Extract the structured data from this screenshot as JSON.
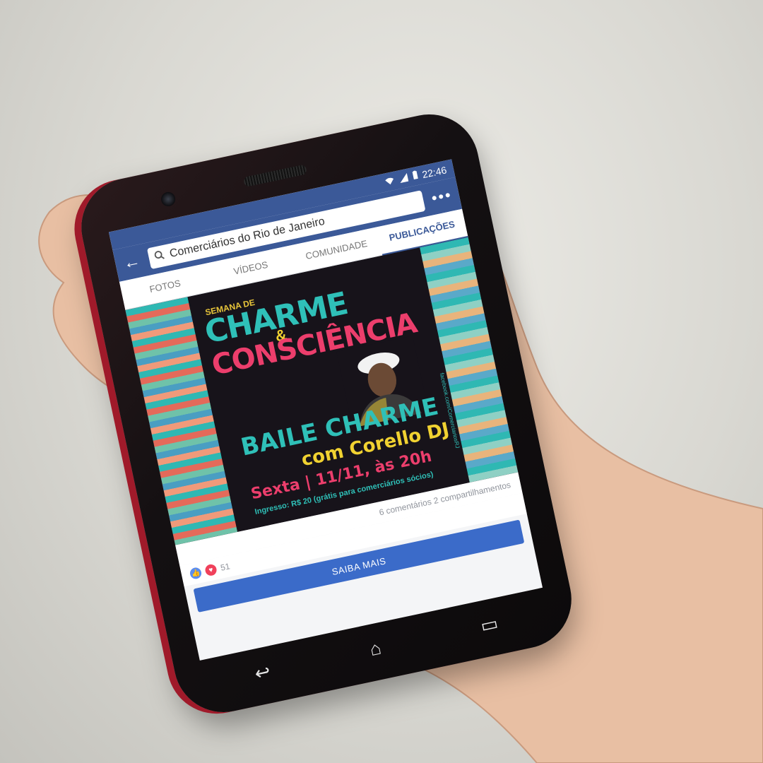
{
  "status": {
    "time": "22:46"
  },
  "appbar": {
    "page_name": "Comerciários do Rio de Janeiro"
  },
  "tabs": [
    "FOTOS",
    "VÍDEOS",
    "COMUNIDADE",
    "PUBLICAÇÕES"
  ],
  "active_tab": "PUBLICAÇÕES",
  "post": {
    "poster": {
      "kicker": "SEMANA DE",
      "title_1": "CHARME",
      "ampersand": "&",
      "title_2": "CONSCIÊNCIA",
      "event": "BAILE CHARME",
      "dj": "com Corello DJ",
      "date": "Sexta | 11/11, às 20h",
      "ticket": "Ingresso: R$ 20 (grátis para comerciários sócios)",
      "side_credit": "facebook.com/ComerciariosRJ"
    },
    "stats": "6 comentários 2 compartilhamentos",
    "reaction_count": "51",
    "cta_label": "SAIBA MAIS"
  },
  "colors": {
    "brand": "#3b5998",
    "cta": "#3b6bc9",
    "teal": "#2fc0b8",
    "pink": "#ec3e6c",
    "yellow": "#f1d231"
  },
  "icons": {
    "back": "back-arrow-icon",
    "search": "search-icon",
    "more": "more-icon",
    "wifi": "wifi-icon",
    "signal": "signal-icon",
    "battery": "battery-icon",
    "like": "like-icon",
    "love": "love-icon",
    "nav_back": "nav-back-icon",
    "nav_home": "nav-home-icon",
    "nav_recents": "nav-recents-icon"
  }
}
